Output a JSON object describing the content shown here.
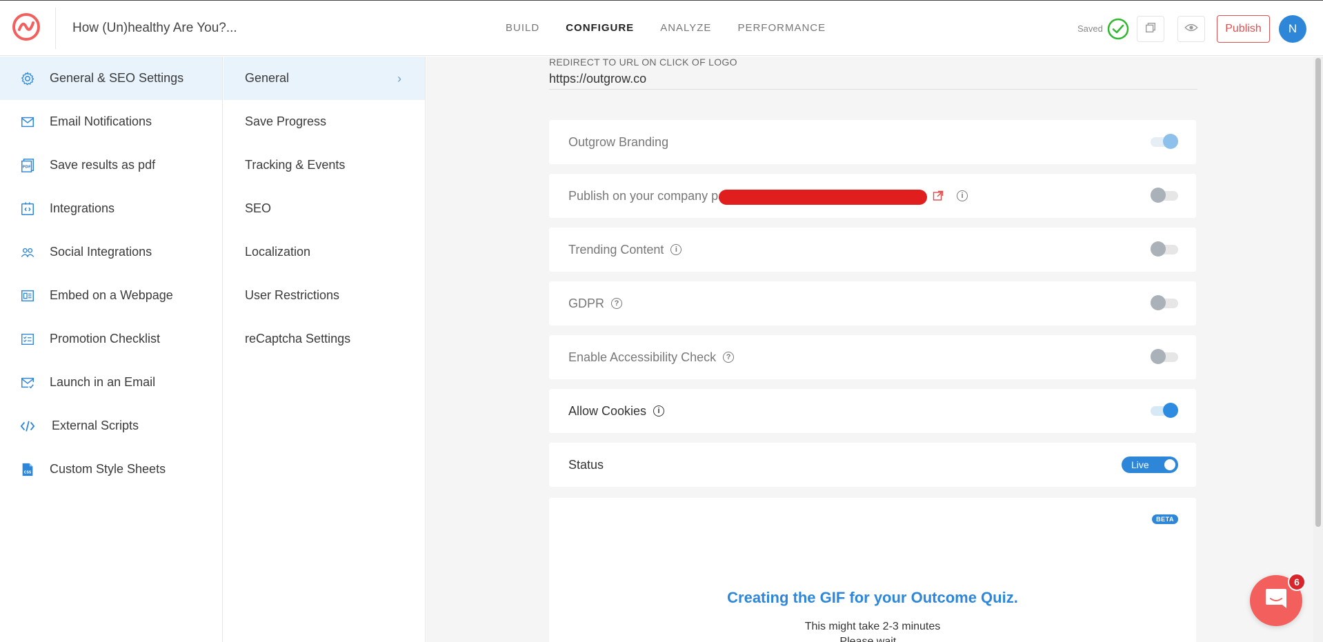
{
  "header": {
    "app_title": "How (Un)healthy Are You?...",
    "tabs": [
      {
        "label": "BUILD",
        "active": false
      },
      {
        "label": "CONFIGURE",
        "active": true
      },
      {
        "label": "ANALYZE",
        "active": false
      },
      {
        "label": "PERFORMANCE",
        "active": false
      }
    ],
    "saved_label": "Saved",
    "publish_label": "Publish",
    "avatar_initial": "N"
  },
  "sidebar": {
    "items": [
      {
        "label": "General & SEO Settings",
        "icon": "gear-icon",
        "active": true
      },
      {
        "label": "Email Notifications",
        "icon": "envelope-icon",
        "active": false
      },
      {
        "label": "Save results as pdf",
        "icon": "pdf-icon",
        "active": false
      },
      {
        "label": "Integrations",
        "icon": "integrations-icon",
        "active": false
      },
      {
        "label": "Social Integrations",
        "icon": "users-icon",
        "active": false
      },
      {
        "label": "Embed on a Webpage",
        "icon": "embed-icon",
        "active": false
      },
      {
        "label": "Promotion Checklist",
        "icon": "checklist-icon",
        "active": false
      },
      {
        "label": "Launch in an Email",
        "icon": "email-launch-icon",
        "active": false
      },
      {
        "label": "External Scripts",
        "icon": "code-icon",
        "active": false
      },
      {
        "label": "Custom Style Sheets",
        "icon": "css-icon",
        "active": false
      }
    ]
  },
  "submenu": {
    "items": [
      {
        "label": "General",
        "active": true
      },
      {
        "label": "Save Progress",
        "active": false
      },
      {
        "label": "Tracking & Events",
        "active": false
      },
      {
        "label": "SEO",
        "active": false
      },
      {
        "label": "Localization",
        "active": false
      },
      {
        "label": "User Restrictions",
        "active": false
      },
      {
        "label": "reCaptcha Settings",
        "active": false
      }
    ]
  },
  "main": {
    "redirect_label": "REDIRECT TO URL ON CLICK OF LOGO",
    "redirect_value": "https://outgrow.co",
    "settings": [
      {
        "label": "Outgrow Branding",
        "state": "on",
        "info": false
      },
      {
        "label": "Publish on your company page",
        "state": "off",
        "info": true
      },
      {
        "label": "Trending Content",
        "state": "off",
        "info": true
      },
      {
        "label": "GDPR",
        "state": "off",
        "info": true
      },
      {
        "label": "Enable Accessibility Check",
        "state": "off",
        "info": true
      },
      {
        "label": "Allow Cookies",
        "state": "on",
        "info": true
      },
      {
        "label": "Status",
        "state": "live",
        "info": false
      }
    ],
    "status_value": "Live",
    "gif_card": {
      "badge": "BETA",
      "title": "Creating the GIF for your Outcome Quiz.",
      "subtitle": "This might take 2-3 minutes",
      "subtitle2": "Please wait..."
    }
  },
  "chat": {
    "badge_count": "6"
  },
  "colors": {
    "accent": "#2d86d8",
    "brand": "#f25f5c",
    "publish": "#e05050",
    "saved_check": "#2eb82e"
  }
}
